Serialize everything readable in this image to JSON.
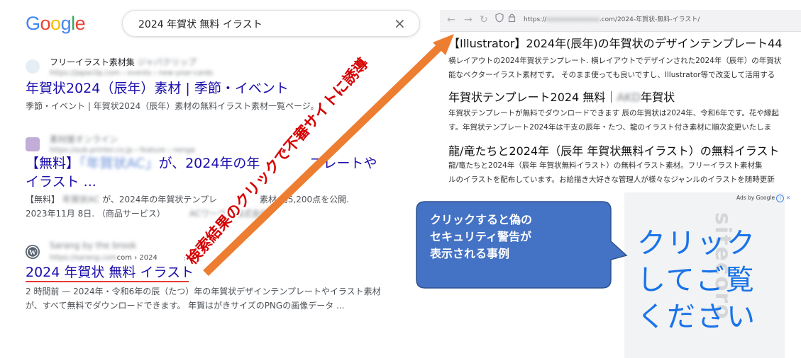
{
  "serp": {
    "logo": [
      "G",
      "o",
      "o",
      "g",
      "l",
      "e"
    ],
    "logo_colors": [
      "#4285F4",
      "#EA4335",
      "#FBBC05",
      "#4285F4",
      "#34A853",
      "#EA4335"
    ],
    "search_query": "2024 年賀状 無料 イラスト",
    "clear_icon": "×",
    "results": [
      {
        "site": "フリーイラスト素材集",
        "site_blur": "ジャパクリップ",
        "url": "https://japaclip.com › events › new-year-cards",
        "title": "年賀状2024（辰年）素材 | 季節・イベント",
        "snippet": "季節・イベント | 年賀状2024（辰年）素材の無料イラスト素材一覧ページ。"
      },
      {
        "site_blur": "素材屋オンライン",
        "url": "https://sub.printer.co.jp › feature › nenga",
        "title_line1_a": "【無料】",
        "title_line1_blur": "「年賀状AC」",
        "title_line1_b": "が、2024年の年",
        "title_line1_c": "プレートや",
        "title_line2": "イラスト ...",
        "snippet_line1_a": "【無料】",
        "snippet_line1_blur": "年賀状AC",
        "snippet_line1_b": "が、2024年の年賀状テンプレ",
        "snippet_line1_c": "素材 約5,200点を公開.",
        "snippet_line2_a": "2023年11月 8日. （商品サービス）",
        "snippet_line2_blur": "ACワークス株式会社"
      },
      {
        "site": "Sarang by the brook",
        "url_blur": "https://sarang.com",
        "url_tail": "com › 2024",
        "title": "2024 年賀状 無料 イラスト",
        "snippet_line1": "2 時間前 — 2024年・令和6年の辰（たつ）年の年賀状デザインテンプレートやイラスト素材",
        "snippet_line2": "が、すべて無料でダウンロードできます。 年賀はがきサイズのPNGの画像データ ..."
      }
    ]
  },
  "site": {
    "url_prefix": "https://",
    "url_blur": "xxxxxxxxxxxxxx",
    "url_suffix": ".com/2024-年賀状-無料-イラスト/",
    "heading1": "【Illustrator】2024年(辰年)の年賀状のデザインテンプレート44",
    "para1_line1": "横レイアウトの2024年賀状テンプレート. 横レイアウトでデザインされた2024年（辰年）の年賀状",
    "para1_line2": "能なベクターイラスト素材です。 そのまま使っても良いですし、Illustrator等で改変して活用する",
    "heading2_a": "年賀状テンプレート2024 無料｜",
    "heading2_blur": "AKD",
    "heading2_b": "年賀状",
    "para2_line1": "年賀状テンプレートが無料でダウンロードできます 辰の年賀状は2024年、令和6年です。花や縁起",
    "para2_line2": "す。年賀状テンプレート2024年は干支の辰年・たつ、龍のイラスト付き素材に順次変更いたしま",
    "heading3": "龍/竜たちと2024年（辰年 年賀状無料イラスト）の無料イラスト",
    "para3_line1": "龍/竜たちと2024年（辰年 年賀状無料イラスト）の無料イラスト素材。フリーイラスト素材集",
    "para3_line2": "ルのイラストを配布しています。お絵描き大好きな管理人が様々なジャンルのイラストを随時更新"
  },
  "ad": {
    "label": "Ads by Google",
    "close": "✕",
    "text_lines": [
      "クリック",
      "してご覧",
      "ください"
    ],
    "watermark": "sitecoro"
  },
  "callout": {
    "lines": [
      "クリックすると偽の",
      "セキュリティ警告が",
      "表示される事例"
    ]
  },
  "arrow": {
    "label": "検索結果のクリックで不審サイトに誘導",
    "color": "#ED7D31"
  }
}
